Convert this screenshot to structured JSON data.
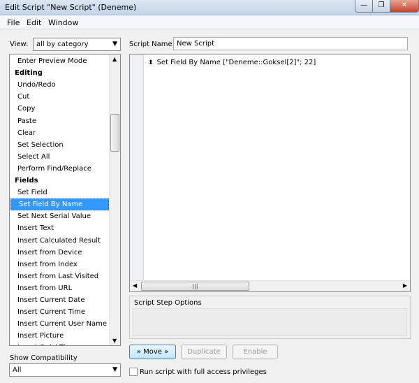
{
  "window": {
    "title": "Edit Script \"New Script\" (Deneme)",
    "minimize": "—",
    "maximize": "❐",
    "close": "✕"
  },
  "menu": {
    "file": "File",
    "edit": "Edit",
    "window": "Window"
  },
  "view": {
    "label": "View:",
    "value": "all by category"
  },
  "script_name": {
    "label": "Script Name:",
    "value": "New Script"
  },
  "steps": [
    {
      "label": "Enter Preview Mode",
      "type": "item"
    },
    {
      "label": "Editing",
      "type": "category"
    },
    {
      "label": "Undo/Redo",
      "type": "item"
    },
    {
      "label": "Cut",
      "type": "item"
    },
    {
      "label": "Copy",
      "type": "item"
    },
    {
      "label": "Paste",
      "type": "item"
    },
    {
      "label": "Clear",
      "type": "item"
    },
    {
      "label": "Set Selection",
      "type": "item"
    },
    {
      "label": "Select All",
      "type": "item"
    },
    {
      "label": "Perform Find/Replace",
      "type": "item"
    },
    {
      "label": "Fields",
      "type": "category"
    },
    {
      "label": "Set Field",
      "type": "item"
    },
    {
      "label": "Set Field By Name",
      "type": "item",
      "selected": true
    },
    {
      "label": "Set Next Serial Value",
      "type": "item"
    },
    {
      "label": "Insert Text",
      "type": "item"
    },
    {
      "label": "Insert Calculated Result",
      "type": "item"
    },
    {
      "label": "Insert from Device",
      "type": "item"
    },
    {
      "label": "Insert from Index",
      "type": "item"
    },
    {
      "label": "Insert from Last Visited",
      "type": "item"
    },
    {
      "label": "Insert from URL",
      "type": "item"
    },
    {
      "label": "Insert Current Date",
      "type": "item"
    },
    {
      "label": "Insert Current Time",
      "type": "item"
    },
    {
      "label": "Insert Current User Name",
      "type": "item"
    },
    {
      "label": "Insert Picture",
      "type": "item"
    },
    {
      "label": "Insert QuickTime",
      "type": "item"
    }
  ],
  "script_lines": [
    "Set Field By Name [\"Deneme::Goksel[2]\"; 22]"
  ],
  "options": {
    "label": "Script Step Options"
  },
  "compat": {
    "label": "Show Compatibility",
    "value": "All"
  },
  "buttons": {
    "move": "» Move »",
    "duplicate": "Duplicate",
    "enable": "Enable"
  },
  "full_access": {
    "label": "Run script with full access privileges",
    "checked": false
  },
  "icons": {
    "dropdown": "chevron-down-icon",
    "move_handle": "move-handle-icon"
  }
}
